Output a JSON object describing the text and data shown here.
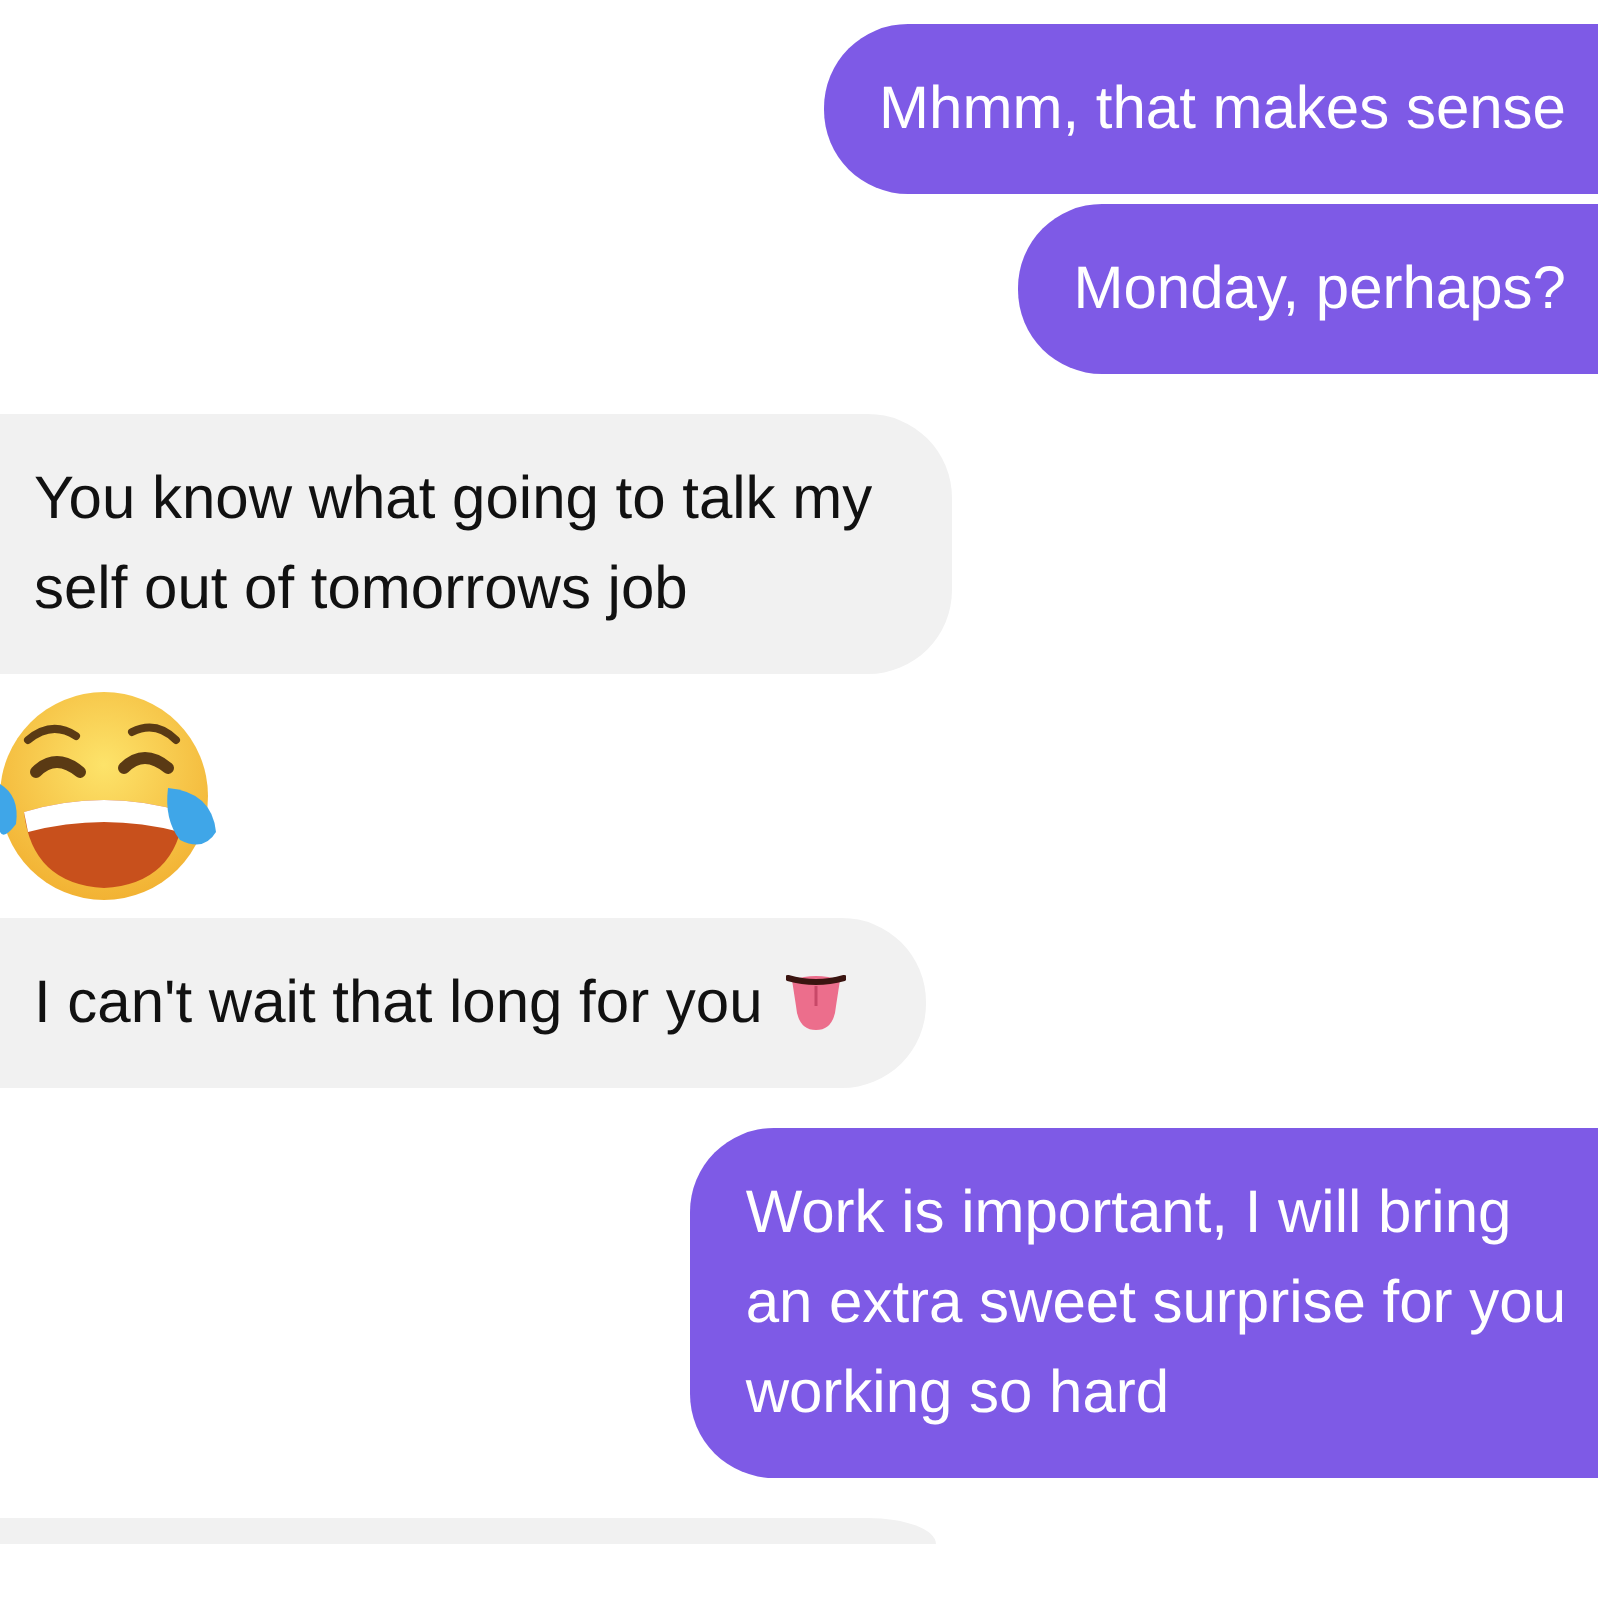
{
  "messages": [
    {
      "sent": true,
      "kind": "text",
      "lines": [
        "Mhmm, that makes sense"
      ]
    },
    {
      "sent": true,
      "kind": "text",
      "lines": [
        "Monday, perhaps?"
      ]
    },
    {
      "sent": false,
      "kind": "text",
      "lines": [
        "You know what going to talk my",
        "self out of tomorrows job"
      ]
    },
    {
      "sent": false,
      "kind": "laughing"
    },
    {
      "sent": false,
      "kind": "text",
      "lines": [
        "I can't wait that long for you"
      ],
      "tongue_emoji": true
    },
    {
      "sent": true,
      "kind": "text",
      "lines": [
        "Work is important, I will bring",
        "an extra sweet surprise for you",
        "working so hard"
      ]
    },
    {
      "sent": false,
      "kind": "cut"
    }
  ]
}
